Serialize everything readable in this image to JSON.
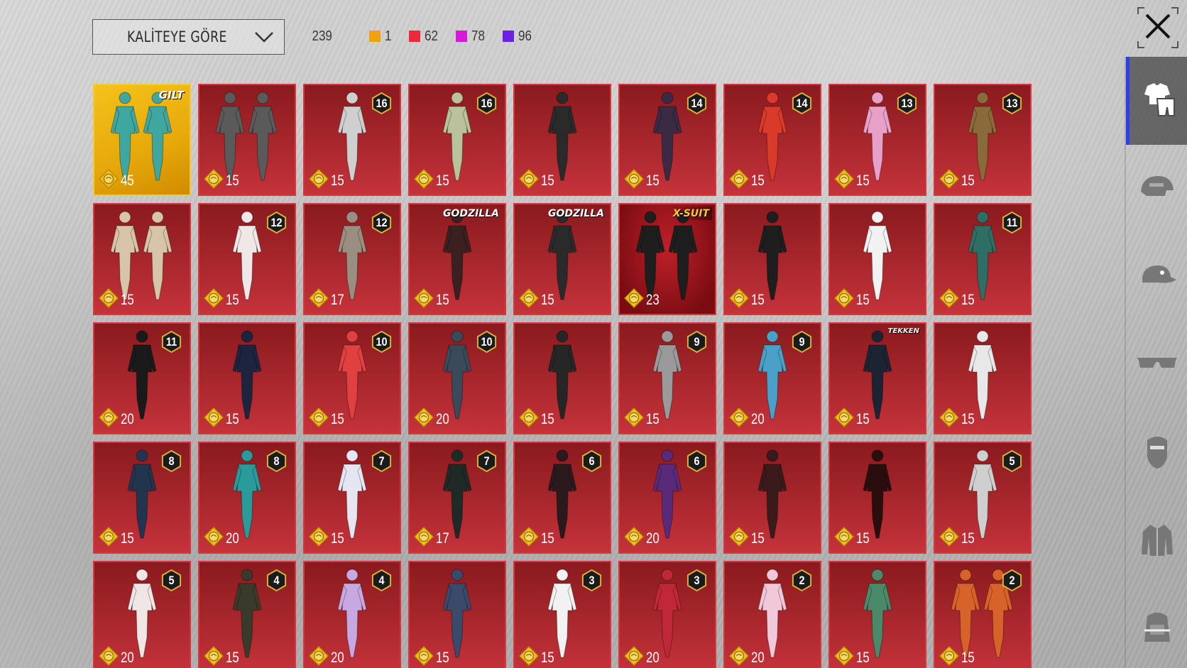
{
  "sort": {
    "label": "KALİTEYE GÖRE"
  },
  "counts": {
    "total": "239",
    "tiers": [
      {
        "color": "#f2a20c",
        "count": "1"
      },
      {
        "color": "#ee2a3a",
        "count": "62"
      },
      {
        "color": "#d51ad9",
        "count": "78"
      },
      {
        "color": "#6a22e0",
        "count": "96"
      }
    ]
  },
  "colors": {
    "accent": "#2b3ff0",
    "card_red": "#c5323a",
    "card_gold": "#f5c21a"
  },
  "sidebar": {
    "items": [
      {
        "icon": "outfit-icon",
        "active": true
      },
      {
        "icon": "helmet-icon",
        "active": false
      },
      {
        "icon": "cap-icon",
        "active": false
      },
      {
        "icon": "glasses-icon",
        "active": false
      },
      {
        "icon": "mask-icon",
        "active": false
      },
      {
        "icon": "jacket-icon",
        "active": false
      },
      {
        "icon": "backpack-icon",
        "active": false
      }
    ]
  },
  "items": [
    {
      "price": "45",
      "level": "",
      "tag": "GILT",
      "style": "gold",
      "tint": "#3fa6a0",
      "figures": 2
    },
    {
      "price": "15",
      "level": "",
      "tag": "",
      "style": "red",
      "tint": "#5a5a5a",
      "figures": 2
    },
    {
      "price": "15",
      "level": "16",
      "tag": "",
      "style": "red",
      "tint": "#cfcfcf",
      "figures": 1
    },
    {
      "price": "15",
      "level": "16",
      "tag": "",
      "style": "red",
      "tint": "#b9c29a",
      "figures": 1
    },
    {
      "price": "15",
      "level": "",
      "tag": "",
      "style": "red",
      "tint": "#2a2a2a",
      "figures": 1
    },
    {
      "price": "15",
      "level": "14",
      "tag": "",
      "style": "red",
      "tint": "#3a2a44",
      "figures": 1
    },
    {
      "price": "15",
      "level": "14",
      "tag": "",
      "style": "red",
      "tint": "#d93a2a",
      "figures": 1
    },
    {
      "price": "15",
      "level": "13",
      "tag": "",
      "style": "red",
      "tint": "#e8a0c8",
      "figures": 1
    },
    {
      "price": "15",
      "level": "13",
      "tag": "",
      "style": "red",
      "tint": "#8a6a3a",
      "figures": 1
    },
    {
      "price": "15",
      "level": "",
      "tag": "",
      "style": "red",
      "tint": "#d8c4a8",
      "figures": 2
    },
    {
      "price": "15",
      "level": "12",
      "tag": "",
      "style": "red",
      "tint": "#f0e8e8",
      "figures": 1
    },
    {
      "price": "17",
      "level": "12",
      "tag": "",
      "style": "red",
      "tint": "#9a8e80",
      "figures": 1
    },
    {
      "price": "15",
      "level": "",
      "tag": "GODZILLA",
      "style": "red",
      "tint": "#3a2020",
      "figures": 1
    },
    {
      "price": "15",
      "level": "",
      "tag": "GODZILLA",
      "style": "red",
      "tint": "#2a2a2a",
      "figures": 1
    },
    {
      "price": "23",
      "level": "",
      "tag": "X-SUIT",
      "style": "xsuit",
      "tint": "#1e1e1e",
      "figures": 2
    },
    {
      "price": "15",
      "level": "",
      "tag": "",
      "style": "red",
      "tint": "#1e1e1e",
      "figures": 1
    },
    {
      "price": "15",
      "level": "",
      "tag": "",
      "style": "red",
      "tint": "#f2f2f2",
      "figures": 1
    },
    {
      "price": "15",
      "level": "11",
      "tag": "",
      "style": "red",
      "tint": "#2f6e64",
      "figures": 1
    },
    {
      "price": "20",
      "level": "11",
      "tag": "",
      "style": "red",
      "tint": "#1a1a1a",
      "figures": 1
    },
    {
      "price": "15",
      "level": "",
      "tag": "",
      "style": "red",
      "tint": "#1c2440",
      "figures": 1
    },
    {
      "price": "15",
      "level": "10",
      "tag": "",
      "style": "red",
      "tint": "#e04040",
      "figures": 1
    },
    {
      "price": "20",
      "level": "10",
      "tag": "",
      "style": "red",
      "tint": "#3a4a5a",
      "figures": 1
    },
    {
      "price": "15",
      "level": "",
      "tag": "",
      "style": "red",
      "tint": "#262626",
      "figures": 1
    },
    {
      "price": "15",
      "level": "9",
      "tag": "",
      "style": "red",
      "tint": "#9a9a9a",
      "figures": 1
    },
    {
      "price": "20",
      "level": "9",
      "tag": "",
      "style": "red",
      "tint": "#4aa0c8",
      "figures": 1
    },
    {
      "price": "15",
      "level": "",
      "tag": "TEKKEN",
      "style": "red",
      "tint": "#1c2434",
      "figures": 1
    },
    {
      "price": "15",
      "level": "",
      "tag": "",
      "style": "red",
      "tint": "#e8e8e8",
      "figures": 1
    },
    {
      "price": "15",
      "level": "8",
      "tag": "",
      "style": "red",
      "tint": "#23344e",
      "figures": 1
    },
    {
      "price": "20",
      "level": "8",
      "tag": "",
      "style": "red",
      "tint": "#2a9a9a",
      "figures": 1
    },
    {
      "price": "15",
      "level": "7",
      "tag": "",
      "style": "red",
      "tint": "#e6e6f2",
      "figures": 1
    },
    {
      "price": "17",
      "level": "7",
      "tag": "",
      "style": "red",
      "tint": "#1f2a26",
      "figures": 1
    },
    {
      "price": "15",
      "level": "6",
      "tag": "",
      "style": "red",
      "tint": "#2a1a1e",
      "figures": 1
    },
    {
      "price": "20",
      "level": "6",
      "tag": "",
      "style": "red",
      "tint": "#5a2a7a",
      "figures": 1
    },
    {
      "price": "15",
      "level": "",
      "tag": "",
      "style": "red",
      "tint": "#3a1a1a",
      "figures": 1
    },
    {
      "price": "15",
      "level": "",
      "tag": "",
      "style": "red",
      "tint": "#2a0e0e",
      "figures": 1
    },
    {
      "price": "15",
      "level": "5",
      "tag": "",
      "style": "red",
      "tint": "#cfcfcf",
      "figures": 1
    },
    {
      "price": "20",
      "level": "5",
      "tag": "",
      "style": "red",
      "tint": "#f0e6e6",
      "figures": 1
    },
    {
      "price": "15",
      "level": "4",
      "tag": "",
      "style": "red",
      "tint": "#3a3a2a",
      "figures": 1
    },
    {
      "price": "20",
      "level": "4",
      "tag": "",
      "style": "red",
      "tint": "#c8a8e0",
      "figures": 1
    },
    {
      "price": "15",
      "level": "",
      "tag": "",
      "style": "red",
      "tint": "#3a4a6a",
      "figures": 1
    },
    {
      "price": "15",
      "level": "3",
      "tag": "",
      "style": "red",
      "tint": "#f2f2f2",
      "figures": 1
    },
    {
      "price": "20",
      "level": "3",
      "tag": "",
      "style": "red",
      "tint": "#c02838",
      "figures": 1
    },
    {
      "price": "20",
      "level": "2",
      "tag": "",
      "style": "red",
      "tint": "#f0c8d8",
      "figures": 1
    },
    {
      "price": "15",
      "level": "",
      "tag": "",
      "style": "red",
      "tint": "#4a8a6a",
      "figures": 1
    },
    {
      "price": "15",
      "level": "2",
      "tag": "",
      "style": "red",
      "tint": "#d8632a",
      "figures": 2
    }
  ]
}
